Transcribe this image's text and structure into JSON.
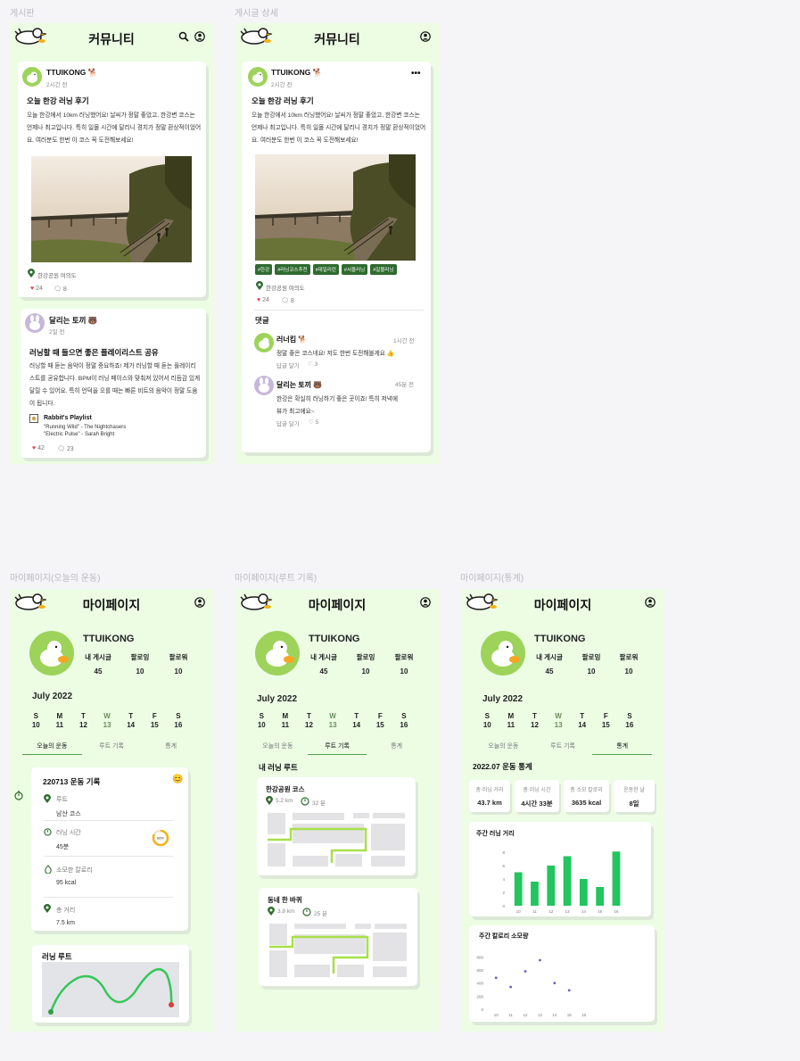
{
  "labels": {
    "board": "게시판",
    "detail": "게시글 상세",
    "today": "마이페이지(오늘의 운동)",
    "route": "마이페이지(루트 기록)",
    "stats": "마이페이지(통계)"
  },
  "community_title": "커뮤니티",
  "mypage_title": "마이페이지",
  "post1": {
    "user": "TTUIKONG 🐕",
    "time": "2시간 전",
    "title": "오늘 한강 러닝 후기",
    "body": "오늘 한강에서 10km 러닝했어요! 날씨가 정말 좋았고, 한강변 코스는 언제나 최고입니다. 특히 일몰 시간에 달리니 경치가 정말 환상적이었어요. 여러분도 한번 이 코스 꼭 도전해보세요!",
    "location": "한강공원 여의도",
    "likes": "24",
    "comments": "8"
  },
  "post2": {
    "user": "달리는 토끼 🐻",
    "time": "2일 전",
    "title": "러닝할 때 들으면 좋은 플레이리스트 공유",
    "body": "러닝할 때 듣는 음악이 정말 중요하죠! 제가 러닝할 때 듣는 플레이리스트를 공유합니다. BPM이 러닝 페이스와 맞춰져 있어서 리듬감 있게 달릴 수 있어요. 특히 언덕을 오를 때는 빠른 비트의 음악이 정말 도움이 됩니다.",
    "playlist_title": "Rabbit's Playlist",
    "track1": "\"Running Wild\" - The Nightchasers",
    "track2": "\"Electric Pulse\" - Sarah Bright",
    "likes": "42",
    "comments": "23"
  },
  "detail": {
    "more": "•••",
    "tags": [
      "#한강",
      "#러닝코스추천",
      "#데일리런",
      "#서울러닝",
      "#일몰러닝"
    ],
    "comments_heading": "댓글",
    "c1": {
      "user": "러너킴 🐕",
      "time": "1시간 전",
      "text": "정말 좋은 코스네요! 저도 한번 도전해볼게요 👍",
      "actions": "답글 달기",
      "likes": "♡ 3"
    },
    "c2": {
      "user": "달리는 토끼 🐻",
      "time": "45분 전",
      "text1": "한강은 확실히 러닝하기 좋은 곳이죠! 특히 저녁에",
      "text2": "뷰가 최고에요~",
      "actions": "답글 달기",
      "likes": "♡ 5"
    }
  },
  "profile": {
    "name": "TTUIKONG",
    "posts_label": "내 게시글",
    "posts": "45",
    "following_label": "팔로잉",
    "following": "10",
    "followers_label": "팔로워",
    "followers": "10",
    "month": "July 2022",
    "days": [
      {
        "d": "S",
        "n": "10"
      },
      {
        "d": "M",
        "n": "11"
      },
      {
        "d": "T",
        "n": "12"
      },
      {
        "d": "W",
        "n": "13"
      },
      {
        "d": "T",
        "n": "14"
      },
      {
        "d": "F",
        "n": "15"
      },
      {
        "d": "S",
        "n": "16"
      }
    ],
    "tabs": [
      "오늘의 운동",
      "루트 기록",
      "통계"
    ]
  },
  "today": {
    "title": "220713 운동 기록",
    "route_label": "루트",
    "route": "남산 코스",
    "time_label": "러닝 시간",
    "time": "45분",
    "progress": "86%",
    "cal_label": "소모한 칼로리",
    "cal": "95 kcal",
    "dist_label": "총 거리",
    "dist": "7.5 km",
    "map_title": "러닝 루트"
  },
  "routes": {
    "heading": "내 러닝 루트",
    "r1": {
      "name": "한강공원 코스",
      "dist": "5.2 km",
      "time": "32 분"
    },
    "r2": {
      "name": "동네 한 바퀴",
      "dist": "3.8 km",
      "time": "25 분"
    }
  },
  "stats": {
    "heading": "2022.07 운동 통계",
    "cards": [
      {
        "label": "총 러닝 거리",
        "value": "43.7 km"
      },
      {
        "label": "총 러닝 시간",
        "value": "4시간 33분"
      },
      {
        "label": "총 소모 칼로리",
        "value": "3635 kcal"
      },
      {
        "label": "운동한 날",
        "value": "8일"
      }
    ]
  },
  "chart_data": [
    {
      "type": "bar",
      "title": "주간 러닝 거리",
      "categories": [
        "10",
        "11",
        "12",
        "13",
        "14",
        "15",
        "16"
      ],
      "values": [
        5,
        3.6,
        6,
        7.4,
        4,
        2.8,
        8.1
      ],
      "yticks": [
        "0",
        "2",
        "4",
        "6",
        "8"
      ],
      "ylim": [
        0,
        8.8
      ],
      "color": "#22c55e"
    },
    {
      "type": "scatter",
      "title": "주간 칼로리 소모량",
      "categories": [
        "10",
        "11",
        "12",
        "13",
        "14",
        "15",
        "16"
      ],
      "values": [
        480,
        340,
        580,
        750,
        400,
        290
      ],
      "yticks": [
        "0",
        "200",
        "400",
        "600",
        "800"
      ],
      "ylim": [
        0,
        900
      ],
      "color": "#6d5bd0"
    }
  ]
}
